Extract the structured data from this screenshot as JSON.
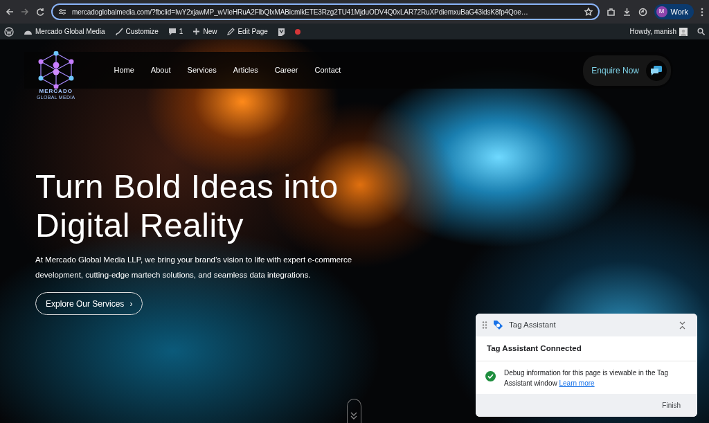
{
  "browser": {
    "url": "mercadoglobalmedia.com/?fbclid=IwY2xjawMP_wVleHRuA2FlbQIxMABicmlkETE3Rzg2TU41MjduODV4Q0xLAR72RuXPdiemxuBaG43idsK8fp4Qoe…",
    "profile_initial": "M",
    "profile_name": "Work"
  },
  "admin_bar": {
    "site": "Mercado Global Media",
    "customize": "Customize",
    "comments": "1",
    "new": "New",
    "edit": "Edit Page",
    "greeting": "Howdy, manish"
  },
  "logo": {
    "name": "MERCADO",
    "tagline": "GLOBAL MEDIA"
  },
  "nav": [
    {
      "label": "Home"
    },
    {
      "label": "About"
    },
    {
      "label": "Services"
    },
    {
      "label": "Articles"
    },
    {
      "label": "Career"
    },
    {
      "label": "Contact"
    }
  ],
  "enquire": "Enquire Now",
  "hero": {
    "title_lines": [
      "Turn Bold Ideas into",
      "Digital Reality"
    ],
    "text": "At Mercado Global Media LLP, we bring your brand’s vision to life with expert e-commerce development, cutting-edge martech solutions, and seamless data integrations.",
    "button": "Explore Our Services",
    "button_arrow": "›"
  },
  "tag_assistant": {
    "title": "Tag Assistant",
    "heading": "Tag Assistant Connected",
    "message": "Debug information for this page is viewable in the Tag Assistant window",
    "link": "Learn more",
    "finish": "Finish"
  }
}
